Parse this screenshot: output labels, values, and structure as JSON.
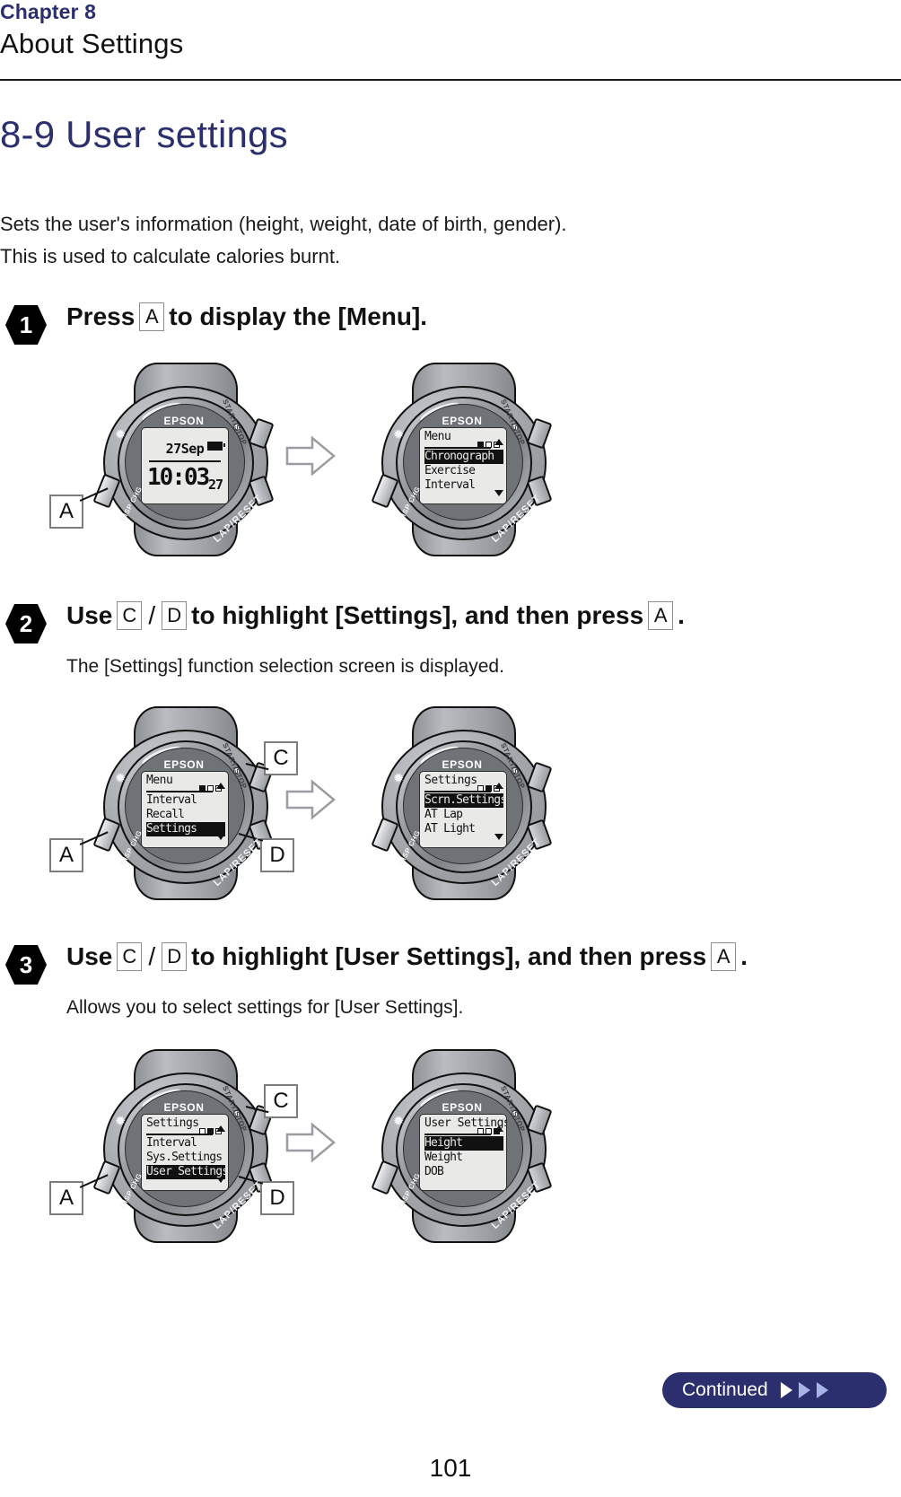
{
  "header": {
    "chapter": "Chapter 8",
    "chapter_title": "About Settings"
  },
  "section": {
    "title": "8-9 User settings"
  },
  "intro": {
    "line1": "Sets the user's information (height, weight, date of birth, gender).",
    "line2": "This is used to calculate calories burnt."
  },
  "steps": [
    {
      "number": "1",
      "text_before": "Press",
      "key1": "A",
      "text_after": "to display the [Menu].",
      "sub": ""
    },
    {
      "number": "2",
      "text_before": "Use",
      "key1": "C",
      "sep": "/",
      "key2": "D",
      "text_mid": "to highlight [Settings], and then press",
      "key3": "A",
      "text_after": ".",
      "sub": "The [Settings] function selection screen is displayed."
    },
    {
      "number": "3",
      "text_before": "Use",
      "key1": "C",
      "sep": "/",
      "key2": "D",
      "text_mid": "to highlight [User Settings], and then press",
      "key3": "A",
      "text_after": ".",
      "sub": "Allows you to select settings for [User Settings]."
    }
  ],
  "watch": {
    "brand": "EPSON",
    "start_stop": "START/STOP",
    "lap_reset": "LAP/RESET",
    "disp_chg": "DISP CHG"
  },
  "screens": {
    "time": {
      "date": "27Sep",
      "time": "10:03",
      "seconds": "27"
    },
    "menu_chrono": {
      "title": "Menu",
      "pager": [
        1,
        0,
        0
      ],
      "rows": [
        "Chronograph",
        "Exercise",
        "Interval"
      ],
      "highlight_index": 0,
      "arrow_up": true,
      "arrow_down": true
    },
    "menu_settings": {
      "title": "Menu",
      "pager": [
        1,
        0,
        0
      ],
      "rows": [
        "Interval",
        "Recall",
        "Settings"
      ],
      "highlight_index": 2,
      "arrow_up": true,
      "arrow_down": true
    },
    "settings": {
      "title": "Settings",
      "pager": [
        0,
        1,
        0
      ],
      "rows": [
        "Scrn.Settings",
        "AT Lap",
        "AT Light"
      ],
      "highlight_index": 0,
      "arrow_up": true,
      "arrow_down": true
    },
    "settings_user": {
      "title": "Settings",
      "pager": [
        0,
        1,
        0
      ],
      "rows": [
        "Interval",
        "Sys.Settings",
        "User Settings"
      ],
      "highlight_index": 2,
      "arrow_up": true,
      "arrow_down": true
    },
    "user_settings": {
      "title": "User Settings",
      "pager": [
        0,
        0,
        1
      ],
      "rows": [
        "Height",
        "Weight",
        "DOB"
      ],
      "highlight_index": 0,
      "arrow_up": true,
      "arrow_down": false
    }
  },
  "callouts": {
    "a": "A",
    "c": "C",
    "d": "D"
  },
  "footer": {
    "page_number": "101",
    "continued": "Continued"
  },
  "colors": {
    "brand_navy": "#2b2f6e",
    "text": "#1a1a1a",
    "lcd_bg": "#e9eae8"
  }
}
